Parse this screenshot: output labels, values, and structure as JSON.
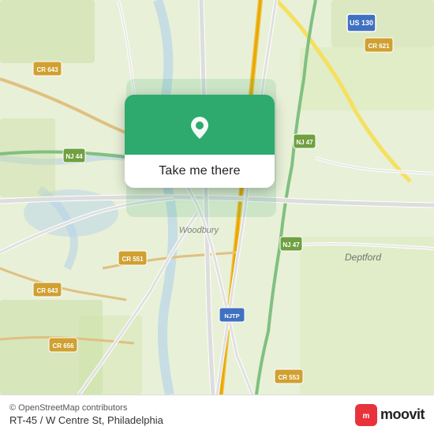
{
  "map": {
    "background_color": "#e8f0d8",
    "center": {
      "lat": 39.85,
      "lng": -75.12
    }
  },
  "popup": {
    "button_label": "Take me there",
    "icon": "location-pin"
  },
  "bottom_bar": {
    "location_text": "RT-45 / W Centre St, Philadelphia",
    "attribution": "© OpenStreetMap contributors",
    "moovit_label": "moovit"
  },
  "road_labels": [
    "US 130",
    "CR 621",
    "CR 643",
    "NJ 44",
    "NJ 47",
    "CR 551",
    "NJTP",
    "CR 643",
    "CR 656",
    "CR 553"
  ],
  "place_labels": [
    "Deptford",
    "Woodbury"
  ]
}
